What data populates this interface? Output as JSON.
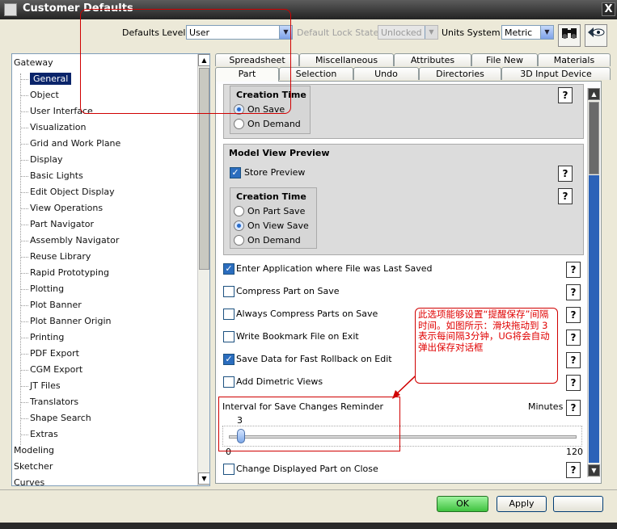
{
  "window": {
    "title": "Customer Defaults",
    "close_glyph": "X"
  },
  "top": {
    "defaults_level_label": "Defaults Level",
    "defaults_level_value": "User",
    "lock_state_label": "Default Lock State",
    "lock_state_value": "Unlocked",
    "units_label": "Units System",
    "units_value": "Metric",
    "binoculars_icon": "binoculars-icon",
    "import_icon": "eye-arrow-icon"
  },
  "tree": {
    "items": [
      "Gateway",
      "General",
      "Object",
      "User Interface",
      "Visualization",
      "Grid and Work Plane",
      "Display",
      "Basic Lights",
      "Edit Object Display",
      "View Operations",
      "Part Navigator",
      "Assembly Navigator",
      "Reuse Library",
      "Rapid Prototyping",
      "Plotting",
      "Plot Banner",
      "Plot Banner Origin",
      "Printing",
      "PDF Export",
      "CGM Export",
      "JT Files",
      "Translators",
      "Shape Search",
      "Extras",
      "Modeling",
      "Sketcher",
      "Curves"
    ],
    "selected": "General"
  },
  "tabs": {
    "row1": [
      "Spreadsheet",
      "Miscellaneous",
      "Attributes",
      "File New",
      "Materials"
    ],
    "row2": [
      "Part",
      "Selection",
      "Undo",
      "Directories",
      "3D Input Device"
    ],
    "active": "Part"
  },
  "panel": {
    "creation_time_top": {
      "title": "Creation Time",
      "options": [
        "On Save",
        "On Demand"
      ],
      "selected": "On Save"
    },
    "model_view_preview": {
      "title": "Model View Preview",
      "store_preview": "Store Preview",
      "creation_time": {
        "title": "Creation Time",
        "options": [
          "On Part Save",
          "On View Save",
          "On Demand"
        ],
        "selected": "On View Save"
      }
    },
    "checkboxes": [
      {
        "label": "Enter Application where File was Last Saved",
        "checked": true
      },
      {
        "label": "Compress Part on Save",
        "checked": false
      },
      {
        "label": "Always Compress Parts on Save",
        "checked": false
      },
      {
        "label": "Write Bookmark File on Exit",
        "checked": false
      },
      {
        "label": "Save Data for Fast Rollback on Edit",
        "checked": true
      },
      {
        "label": "Add Dimetric Views",
        "checked": false
      }
    ],
    "interval": {
      "label": "Interval for Save Changes Reminder",
      "unit": "Minutes",
      "value": "3",
      "min": "0",
      "max": "120"
    },
    "last_checkbox": {
      "label": "Change Displayed Part on Close",
      "checked": false
    },
    "help_glyph": "?"
  },
  "annotation": {
    "callout_text": "此选项能够设置“提醒保存”间隔时间。如图所示：滑块拖动到 3 表示每间隔3分钟，UG将会自动弹出保存对话框",
    "color": "#d00000"
  },
  "buttons": {
    "ok": "OK",
    "apply": "Apply"
  }
}
